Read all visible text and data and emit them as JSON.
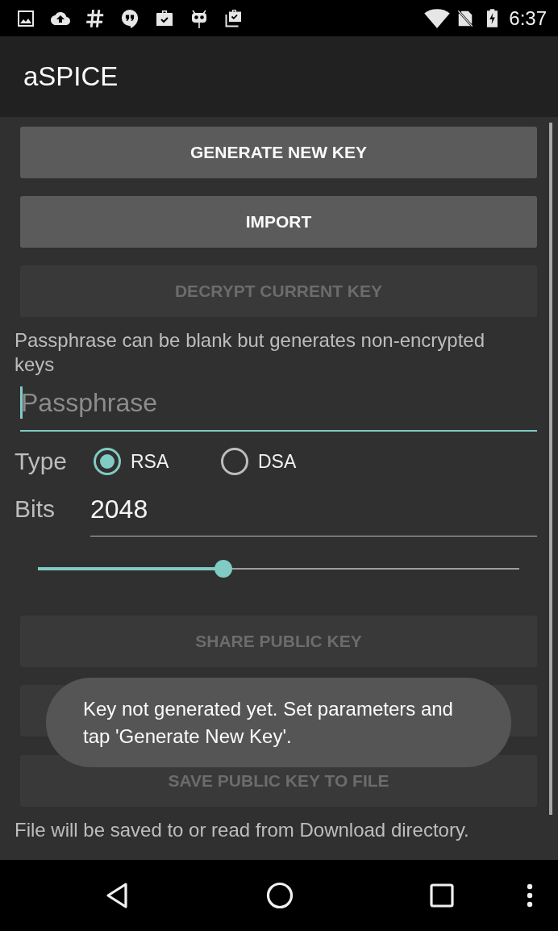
{
  "status_bar": {
    "time": "6:37"
  },
  "app_bar": {
    "title": "aSPICE"
  },
  "buttons_top": [
    {
      "label": "GENERATE NEW KEY",
      "disabled": false
    },
    {
      "label": "IMPORT",
      "disabled": false
    },
    {
      "label": "DECRYPT CURRENT KEY",
      "disabled": true
    }
  ],
  "passphrase_hint": "Passphrase can be blank but generates non-encrypted keys",
  "passphrase_field": {
    "placeholder": "Passphrase",
    "focused": true
  },
  "type": {
    "label": "Type",
    "options": [
      {
        "label": "RSA",
        "selected": true
      },
      {
        "label": "DSA",
        "selected": false
      }
    ]
  },
  "bits": {
    "label": "Bits",
    "value": "2048"
  },
  "bits_slider": {
    "level": 0.385
  },
  "buttons_bottom": [
    {
      "label": "SHARE PUBLIC KEY",
      "disabled": true
    },
    {
      "disabled": true
    },
    {
      "label": "SAVE PUBLIC KEY TO FILE",
      "disabled": true
    }
  ],
  "footer_note": "File will be saved to or read from Download directory.",
  "toast": {
    "message": "Key not generated yet. Set parameters and tap 'Generate New Key'."
  }
}
